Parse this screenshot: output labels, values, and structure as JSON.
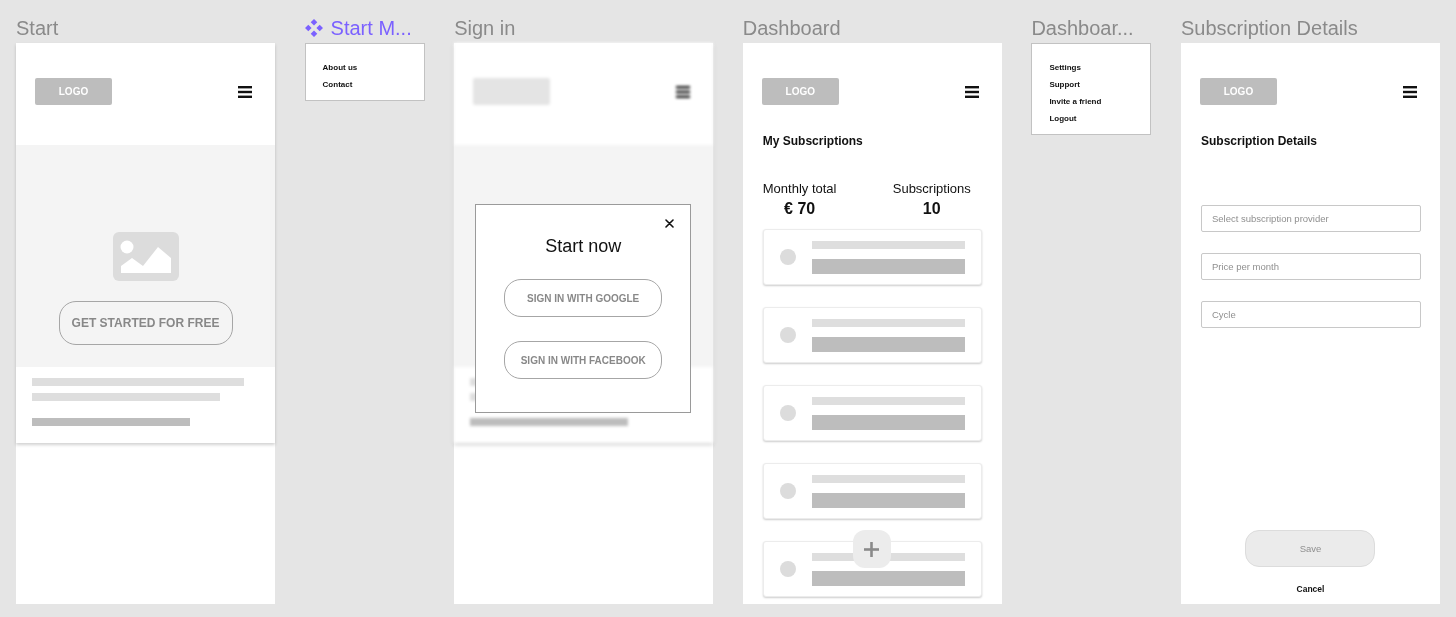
{
  "frames": [
    {
      "kind": "start",
      "title": "Start",
      "logo": "LOGO",
      "hero_button": "GET STARTED FOR FREE",
      "lines": [
        {
          "kind": "subtle"
        },
        {
          "kind": "subtle"
        },
        {
          "kind": "strong"
        }
      ]
    },
    {
      "kind": "menu",
      "title": "Start M...",
      "component": true,
      "items": [
        "About us",
        "Contact"
      ]
    },
    {
      "kind": "signin",
      "title": "Sign in",
      "blurred": true,
      "lines": [
        {
          "kind": "subtle"
        },
        {
          "kind": "subtle"
        },
        {
          "kind": "strong"
        }
      ],
      "modal": {
        "title": "Start now",
        "buttons": [
          "SIGN IN WITH GOOGLE",
          "SIGN IN WITH FACEBOOK"
        ]
      }
    },
    {
      "kind": "dashboard",
      "title": "Dashboard",
      "logo": "LOGO",
      "heading": "My Subscriptions",
      "stats": [
        {
          "label": "Monthly total",
          "value": "€ 70"
        },
        {
          "label": "Subscriptions",
          "value": "10"
        }
      ],
      "cards": [
        {
          "kind": "placeholder"
        },
        {
          "kind": "placeholder"
        },
        {
          "kind": "placeholder"
        },
        {
          "kind": "placeholder"
        },
        {
          "kind": "placeholder"
        }
      ]
    },
    {
      "kind": "menu",
      "title": "Dashboar...",
      "component": false,
      "items": [
        "Settings",
        "Support",
        "Invite a friend",
        "Logout"
      ]
    },
    {
      "kind": "details",
      "title": "Subscription Details",
      "logo": "LOGO",
      "heading": "Subscription Details",
      "fields": [
        {
          "placeholder": "Select subscription provider"
        },
        {
          "placeholder": "Price per month"
        },
        {
          "placeholder": "Cycle"
        }
      ],
      "save": {
        "label": "Save",
        "disabled": true
      },
      "cancel": "Cancel"
    }
  ]
}
